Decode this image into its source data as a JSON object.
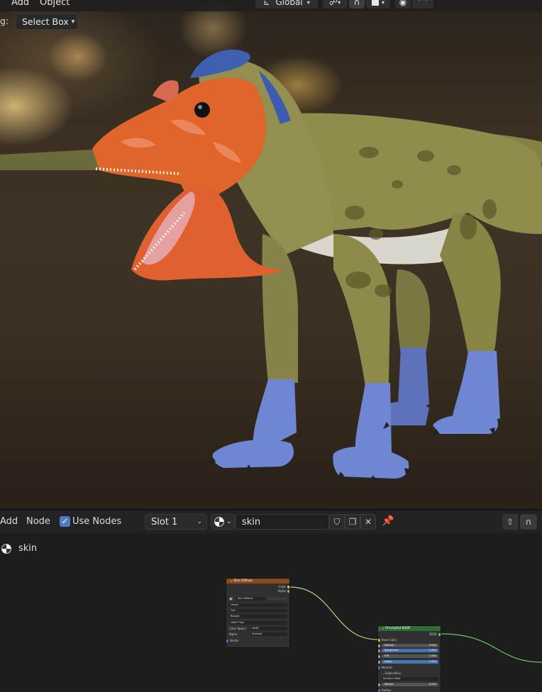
{
  "viewport": {
    "menu": {
      "add": "Add",
      "object": "Object"
    },
    "header": {
      "orientation": "Global",
      "orientation_icon": "transform-axes-icon",
      "pivot_icon": "pivot-icon",
      "snap_icon": "magnet-icon",
      "proportional_icon": "proportional-falloff-icon"
    },
    "drag_label": "g:",
    "select_box": "Select Box"
  },
  "node_editor": {
    "header": {
      "add": "Add",
      "node": "Node",
      "use_nodes_label": "Use Nodes",
      "use_nodes_checked": true,
      "slot": "Slot 1",
      "material_name": "skin",
      "fake_user_icon": "shield-icon",
      "duplicate_icon": "copy-icon",
      "unlink_icon": "close-icon",
      "pin_icon": "pin-icon",
      "parent_icon": "arrow-up-icon",
      "snap_icon": "magnet-icon"
    },
    "breadcrumb": "skin",
    "image_node": {
      "title": "Skin Diffuse",
      "header_color": "#8a4a1e",
      "outputs": {
        "color": "Color",
        "alpha": "Alpha"
      },
      "image": "Skin Diffuse",
      "interpolation": "Linear",
      "projection": "Flat",
      "extension": "Repeat",
      "source": "UDIM Tiles",
      "color_space_label": "Color Space",
      "color_space": "sRGB",
      "alpha_label": "Alpha",
      "alpha_mode": "Straight",
      "vector": "Vector"
    },
    "bsdf_node": {
      "title": "Principled BSDF",
      "header_color": "#2f6b36",
      "output": "BSDF",
      "base_color": "Base Color",
      "metallic": {
        "label": "Metallic",
        "value": "0.000"
      },
      "roughness": {
        "label": "Roughness",
        "value": "1.000"
      },
      "ior": {
        "label": "IOR",
        "value": "1.450"
      },
      "alpha": {
        "label": "Alpha",
        "value": "1.000"
      },
      "normal": "Normal",
      "subsurface": "Subsurface",
      "subsurface_method": "Random Walk",
      "weight": {
        "label": "Weight",
        "value": "0.000"
      },
      "radius": "Radius"
    }
  }
}
